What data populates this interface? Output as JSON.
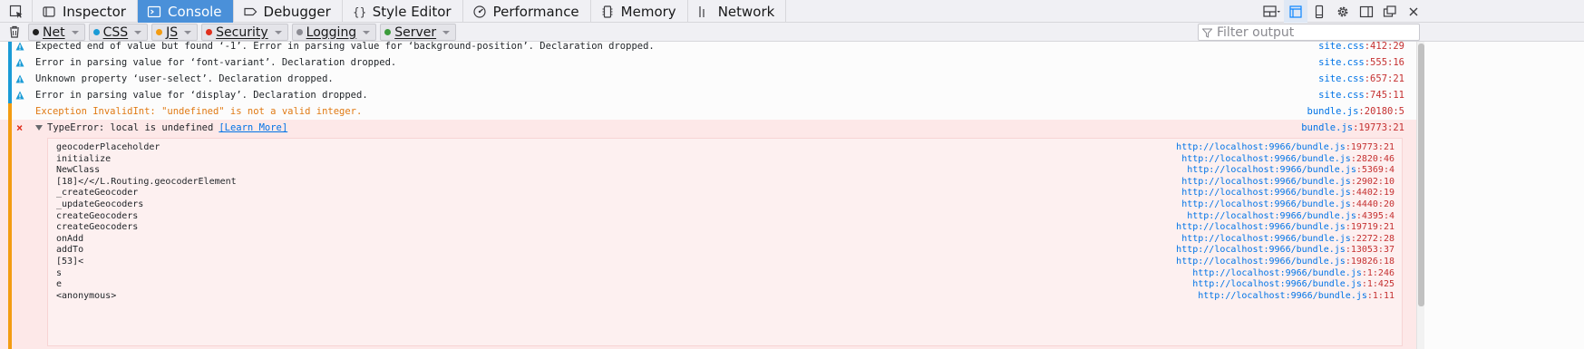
{
  "toolbar": {
    "picker_icon": "element-picker-icon",
    "tabs": [
      {
        "label": "Inspector",
        "icon": "inspector-icon",
        "selected": false
      },
      {
        "label": "Console",
        "icon": "console-icon",
        "selected": true
      },
      {
        "label": "Debugger",
        "icon": "debugger-icon",
        "selected": false
      },
      {
        "label": "Style Editor",
        "icon": "style-editor-icon",
        "selected": false
      },
      {
        "label": "Performance",
        "icon": "performance-icon",
        "selected": false
      },
      {
        "label": "Memory",
        "icon": "memory-icon",
        "selected": false
      },
      {
        "label": "Network",
        "icon": "network-icon",
        "selected": false
      }
    ],
    "right_buttons": [
      "split-layout-icon",
      "responsive-design-icon",
      "mobile-icon",
      "settings-gear-icon",
      "dock-side-icon",
      "undock-window-icon",
      "close-icon"
    ]
  },
  "filterbar": {
    "buttons": [
      {
        "label": "Net",
        "color": "#1f1f1f"
      },
      {
        "label": "CSS",
        "color": "#1a9bd6"
      },
      {
        "label": "JS",
        "color": "#f39c12"
      },
      {
        "label": "Security",
        "color": "#e0301e"
      },
      {
        "label": "Logging",
        "color": "#8c8c94"
      },
      {
        "label": "Server",
        "color": "#3b9b3b"
      }
    ],
    "filter_placeholder": "Filter output"
  },
  "messages": [
    {
      "kind": "warn",
      "text": "Expected end of value but found ‘-1’. Error in parsing value for ‘background-position’. Declaration dropped.",
      "file": "site.css",
      "linecol": ":412:29"
    },
    {
      "kind": "warn",
      "text": "Error in parsing value for ‘font-variant’. Declaration dropped.",
      "file": "site.css",
      "linecol": ":555:16"
    },
    {
      "kind": "warn",
      "text": "Unknown property ‘user-select’. Declaration dropped.",
      "file": "site.css",
      "linecol": ":657:21"
    },
    {
      "kind": "warn",
      "text": "Error in parsing value for ‘display’. Declaration dropped.",
      "file": "site.css",
      "linecol": ":745:11"
    },
    {
      "kind": "exc",
      "text": "Exception InvalidInt: \"undefined\" is not a valid integer.",
      "file": "bundle.js",
      "linecol": ":20180:5"
    }
  ],
  "error": {
    "text": "TypeError: local is undefined",
    "learn_more": "[Learn More]",
    "file": "bundle.js",
    "linecol": ":19773:21",
    "stack": [
      {
        "fn": "geocoderPlaceholder",
        "url": "http://localhost:9966/bundle.js",
        "linecol": ":19773:21"
      },
      {
        "fn": "initialize",
        "url": "http://localhost:9966/bundle.js",
        "linecol": ":2820:46"
      },
      {
        "fn": "NewClass",
        "url": "http://localhost:9966/bundle.js",
        "linecol": ":5369:4"
      },
      {
        "fn": "[18]</</L.Routing.geocoderElement",
        "url": "http://localhost:9966/bundle.js",
        "linecol": ":2902:10"
      },
      {
        "fn": "_createGeocoder",
        "url": "http://localhost:9966/bundle.js",
        "linecol": ":4402:19"
      },
      {
        "fn": "_updateGeocoders",
        "url": "http://localhost:9966/bundle.js",
        "linecol": ":4440:20"
      },
      {
        "fn": "createGeocoders",
        "url": "http://localhost:9966/bundle.js",
        "linecol": ":4395:4"
      },
      {
        "fn": "createGeocoders",
        "url": "http://localhost:9966/bundle.js",
        "linecol": ":19719:21"
      },
      {
        "fn": "onAdd",
        "url": "http://localhost:9966/bundle.js",
        "linecol": ":2272:28"
      },
      {
        "fn": "addTo",
        "url": "http://localhost:9966/bundle.js",
        "linecol": ":13053:37"
      },
      {
        "fn": "[53]<",
        "url": "http://localhost:9966/bundle.js",
        "linecol": ":19826:18"
      },
      {
        "fn": "s",
        "url": "http://localhost:9966/bundle.js",
        "linecol": ":1:246"
      },
      {
        "fn": "e",
        "url": "http://localhost:9966/bundle.js",
        "linecol": ":1:425"
      },
      {
        "fn": "<anonymous>",
        "url": "http://localhost:9966/bundle.js",
        "linecol": ":1:11"
      }
    ]
  }
}
